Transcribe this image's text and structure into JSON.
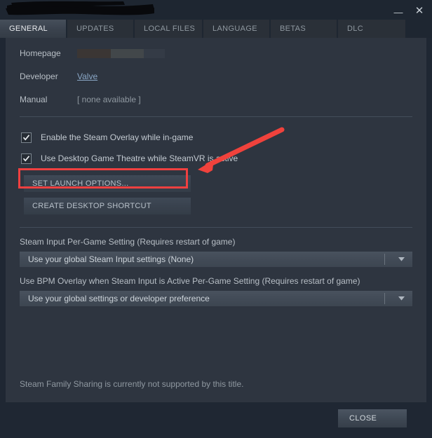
{
  "window": {
    "title_redacted": true,
    "minimize_icon": "minimize-icon",
    "close_icon": "close-icon",
    "minimize_glyph": "—",
    "close_glyph": "✕"
  },
  "tabs": [
    {
      "label": "GENERAL",
      "active": true
    },
    {
      "label": "UPDATES",
      "active": false
    },
    {
      "label": "LOCAL FILES",
      "active": false
    },
    {
      "label": "LANGUAGE",
      "active": false
    },
    {
      "label": "BETAS",
      "active": false
    },
    {
      "label": "DLC",
      "active": false
    }
  ],
  "info_rows": {
    "homepage_label": "Homepage",
    "homepage_value": "",
    "developer_label": "Developer",
    "developer_value": "Valve",
    "manual_label": "Manual",
    "manual_value": "[ none available ]"
  },
  "checkboxes": [
    {
      "label": "Enable the Steam Overlay while in-game",
      "checked": true
    },
    {
      "label": "Use Desktop Game Theatre while SteamVR is active",
      "checked": true
    }
  ],
  "buttons": {
    "set_launch_options": "SET LAUNCH OPTIONS...",
    "create_desktop_shortcut": "CREATE DESKTOP SHORTCUT"
  },
  "steam_input": {
    "label": "Steam Input Per-Game Setting (Requires restart of game)",
    "value": "Use your global Steam Input settings (None)"
  },
  "bpm_overlay": {
    "label": "Use BPM Overlay when Steam Input is Active Per-Game Setting (Requires restart of game)",
    "value": "Use your global settings or developer preference"
  },
  "family_sharing_note": "Steam Family Sharing is currently not supported by this title.",
  "footer": {
    "close_label": "CLOSE"
  },
  "annotations": {
    "highlight_color": "#f04040",
    "arrow_color": "#f0423c",
    "highlight_target": "set-launch-options-button",
    "arrow_target": "set-launch-options-button"
  }
}
